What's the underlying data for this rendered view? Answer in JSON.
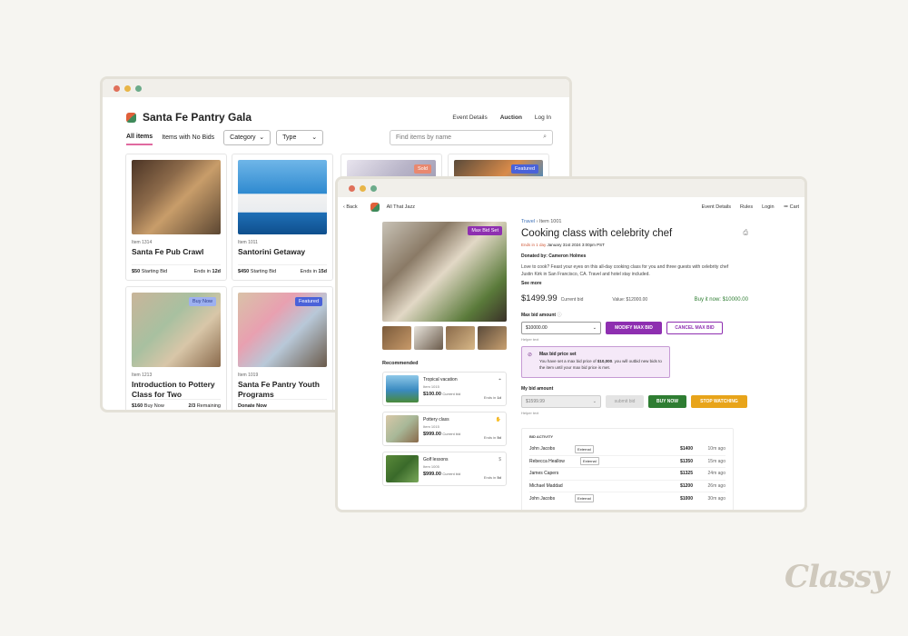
{
  "colors": {
    "window_dot_1": "#e0705a",
    "window_dot_2": "#e8b547",
    "window_dot_3": "#6cab8a",
    "purple": "#8e2fb0",
    "green": "#2e7d32",
    "yellow": "#e8a41a",
    "tab_underline": "#e06aa0",
    "badge_sold": "#e9886f",
    "badge_blue": "#4a62d9"
  },
  "back": {
    "title": "Santa Fe Pantry Gala",
    "nav": [
      "Event Details",
      "Auction",
      "Log In"
    ],
    "tabs": [
      "All items",
      "Items with No Bids"
    ],
    "category_label": "Category",
    "type_label": "Type",
    "search_placeholder": "Find items by name",
    "badges": {
      "sold": "Sold",
      "featured": "Featured",
      "buy_now": "Buy Now"
    },
    "cards": [
      {
        "item": "Item 1314",
        "name": "Santa Fe Pub Crawl",
        "price": "$50",
        "price_label": "Starting Bid",
        "ends": "Ends in",
        "ends_val": "12d"
      },
      {
        "item": "Item 1011",
        "name": "Santorini Getaway",
        "price": "$450",
        "price_label": "Starting Bid",
        "ends": "Ends in",
        "ends_val": "15d"
      },
      {
        "item": "Item 1213",
        "name": "Introduction to Pottery Class for Two",
        "price": "$160",
        "price_label": "Buy Now",
        "ends": "Remaining",
        "ends_val": "2/3"
      },
      {
        "item": "Item 1019",
        "name": "Santa Fe Pantry Youth Programs",
        "price": "Donate Now",
        "price_label": "",
        "ends": "",
        "ends_val": ""
      }
    ]
  },
  "front": {
    "back_label": "Back",
    "org_name": "All That Jazz",
    "nav": [
      "Event Details",
      "Rules",
      "Login",
      "Cart"
    ],
    "max_bid_badge": "Max Bid Set",
    "breadcrumb": [
      "Travel",
      "Item 1001"
    ],
    "title": "Cooking class with celebrity chef",
    "ends_red": "Ends in 1 day",
    "ends_date": "January 31st 2024 3:00pm PST",
    "donor": "Donated by: Cameron Holmes",
    "description": "Love to cook? Feast your eyes on this all-day cooking class for you and three guests with celebrity chef Justin Kirk in San Francisco, CA. Travel and hotel stay included.",
    "see_more": "See more",
    "current_bid": "$1499.99",
    "current_bid_label": "Current bid",
    "value": "Value: $12000.00",
    "buy_now_price": "Buy it now: $10000.00",
    "max_bid_label": "Max bid amount",
    "max_bid_value": "$10000.00",
    "modify_btn": "MODIFY MAX BID",
    "cancel_btn": "CANCEL MAX BID",
    "helper": "Helper text",
    "alert_title": "Max bid price set",
    "alert_body_1": "You have set a max bid price of ",
    "alert_amount": "$10,000",
    "alert_body_2": ". you will outbid new bids to the item until your max bid price is met.",
    "my_bid_label": "My bid amount",
    "my_bid_value": "$1599.99",
    "submit_btn": "submit bid",
    "buy_btn": "BUY NOW",
    "watch_btn": "STOP WATCHING",
    "recommended": "Recommended",
    "reco": [
      {
        "title": "Tropical vacation",
        "item": "Item 1015",
        "price": "$100.00",
        "label": "Current bid",
        "ends": "Ends in",
        "ends_val": "1d"
      },
      {
        "title": "Pottery class",
        "item": "Item 1015",
        "price": "$999.00",
        "label": "Current bid",
        "ends": "Ends in",
        "ends_val": "5d"
      },
      {
        "title": "Golf lessons",
        "item": "Item 1005",
        "price": "$999.00",
        "label": "Current bid",
        "ends": "Ends in",
        "ends_val": "5d"
      }
    ],
    "activity_title": "BID ACTIVITY",
    "external": "External",
    "activity": [
      {
        "name": "John Jacobs",
        "ext": true,
        "amount": "$1400",
        "ago": "10m ago"
      },
      {
        "name": "Rebecca Heallow",
        "ext": true,
        "amount": "$1350",
        "ago": "15m ago"
      },
      {
        "name": "James Capers",
        "ext": false,
        "amount": "$1325",
        "ago": "24m ago"
      },
      {
        "name": "Michael Maddad",
        "ext": false,
        "amount": "$1200",
        "ago": "26m ago"
      },
      {
        "name": "John Jacobs",
        "ext": true,
        "amount": "$1000",
        "ago": "30m ago"
      }
    ]
  },
  "brand": "Classy"
}
